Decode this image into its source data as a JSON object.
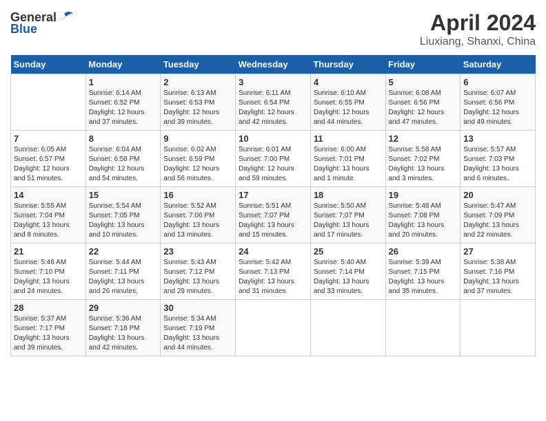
{
  "header": {
    "logo_general": "General",
    "logo_blue": "Blue",
    "title": "April 2024",
    "subtitle": "Liuxiang, Shanxi, China"
  },
  "calendar": {
    "days_of_week": [
      "Sunday",
      "Monday",
      "Tuesday",
      "Wednesday",
      "Thursday",
      "Friday",
      "Saturday"
    ],
    "weeks": [
      [
        {
          "day": "",
          "info": ""
        },
        {
          "day": "1",
          "info": "Sunrise: 6:14 AM\nSunset: 6:52 PM\nDaylight: 12 hours\nand 37 minutes."
        },
        {
          "day": "2",
          "info": "Sunrise: 6:13 AM\nSunset: 6:53 PM\nDaylight: 12 hours\nand 39 minutes."
        },
        {
          "day": "3",
          "info": "Sunrise: 6:11 AM\nSunset: 6:54 PM\nDaylight: 12 hours\nand 42 minutes."
        },
        {
          "day": "4",
          "info": "Sunrise: 6:10 AM\nSunset: 6:55 PM\nDaylight: 12 hours\nand 44 minutes."
        },
        {
          "day": "5",
          "info": "Sunrise: 6:08 AM\nSunset: 6:56 PM\nDaylight: 12 hours\nand 47 minutes."
        },
        {
          "day": "6",
          "info": "Sunrise: 6:07 AM\nSunset: 6:56 PM\nDaylight: 12 hours\nand 49 minutes."
        }
      ],
      [
        {
          "day": "7",
          "info": "Sunrise: 6:05 AM\nSunset: 6:57 PM\nDaylight: 12 hours\nand 51 minutes."
        },
        {
          "day": "8",
          "info": "Sunrise: 6:04 AM\nSunset: 6:58 PM\nDaylight: 12 hours\nand 54 minutes."
        },
        {
          "day": "9",
          "info": "Sunrise: 6:02 AM\nSunset: 6:59 PM\nDaylight: 12 hours\nand 56 minutes."
        },
        {
          "day": "10",
          "info": "Sunrise: 6:01 AM\nSunset: 7:00 PM\nDaylight: 12 hours\nand 59 minutes."
        },
        {
          "day": "11",
          "info": "Sunrise: 6:00 AM\nSunset: 7:01 PM\nDaylight: 13 hours\nand 1 minute."
        },
        {
          "day": "12",
          "info": "Sunrise: 5:58 AM\nSunset: 7:02 PM\nDaylight: 13 hours\nand 3 minutes."
        },
        {
          "day": "13",
          "info": "Sunrise: 5:57 AM\nSunset: 7:03 PM\nDaylight: 13 hours\nand 6 minutes."
        }
      ],
      [
        {
          "day": "14",
          "info": "Sunrise: 5:55 AM\nSunset: 7:04 PM\nDaylight: 13 hours\nand 8 minutes."
        },
        {
          "day": "15",
          "info": "Sunrise: 5:54 AM\nSunset: 7:05 PM\nDaylight: 13 hours\nand 10 minutes."
        },
        {
          "day": "16",
          "info": "Sunrise: 5:52 AM\nSunset: 7:06 PM\nDaylight: 13 hours\nand 13 minutes."
        },
        {
          "day": "17",
          "info": "Sunrise: 5:51 AM\nSunset: 7:07 PM\nDaylight: 13 hours\nand 15 minutes."
        },
        {
          "day": "18",
          "info": "Sunrise: 5:50 AM\nSunset: 7:07 PM\nDaylight: 13 hours\nand 17 minutes."
        },
        {
          "day": "19",
          "info": "Sunrise: 5:48 AM\nSunset: 7:08 PM\nDaylight: 13 hours\nand 20 minutes."
        },
        {
          "day": "20",
          "info": "Sunrise: 5:47 AM\nSunset: 7:09 PM\nDaylight: 13 hours\nand 22 minutes."
        }
      ],
      [
        {
          "day": "21",
          "info": "Sunrise: 5:46 AM\nSunset: 7:10 PM\nDaylight: 13 hours\nand 24 minutes."
        },
        {
          "day": "22",
          "info": "Sunrise: 5:44 AM\nSunset: 7:11 PM\nDaylight: 13 hours\nand 26 minutes."
        },
        {
          "day": "23",
          "info": "Sunrise: 5:43 AM\nSunset: 7:12 PM\nDaylight: 13 hours\nand 29 minutes."
        },
        {
          "day": "24",
          "info": "Sunrise: 5:42 AM\nSunset: 7:13 PM\nDaylight: 13 hours\nand 31 minutes."
        },
        {
          "day": "25",
          "info": "Sunrise: 5:40 AM\nSunset: 7:14 PM\nDaylight: 13 hours\nand 33 minutes."
        },
        {
          "day": "26",
          "info": "Sunrise: 5:39 AM\nSunset: 7:15 PM\nDaylight: 13 hours\nand 35 minutes."
        },
        {
          "day": "27",
          "info": "Sunrise: 5:38 AM\nSunset: 7:16 PM\nDaylight: 13 hours\nand 37 minutes."
        }
      ],
      [
        {
          "day": "28",
          "info": "Sunrise: 5:37 AM\nSunset: 7:17 PM\nDaylight: 13 hours\nand 39 minutes."
        },
        {
          "day": "29",
          "info": "Sunrise: 5:36 AM\nSunset: 7:18 PM\nDaylight: 13 hours\nand 42 minutes."
        },
        {
          "day": "30",
          "info": "Sunrise: 5:34 AM\nSunset: 7:19 PM\nDaylight: 13 hours\nand 44 minutes."
        },
        {
          "day": "",
          "info": ""
        },
        {
          "day": "",
          "info": ""
        },
        {
          "day": "",
          "info": ""
        },
        {
          "day": "",
          "info": ""
        }
      ]
    ]
  }
}
